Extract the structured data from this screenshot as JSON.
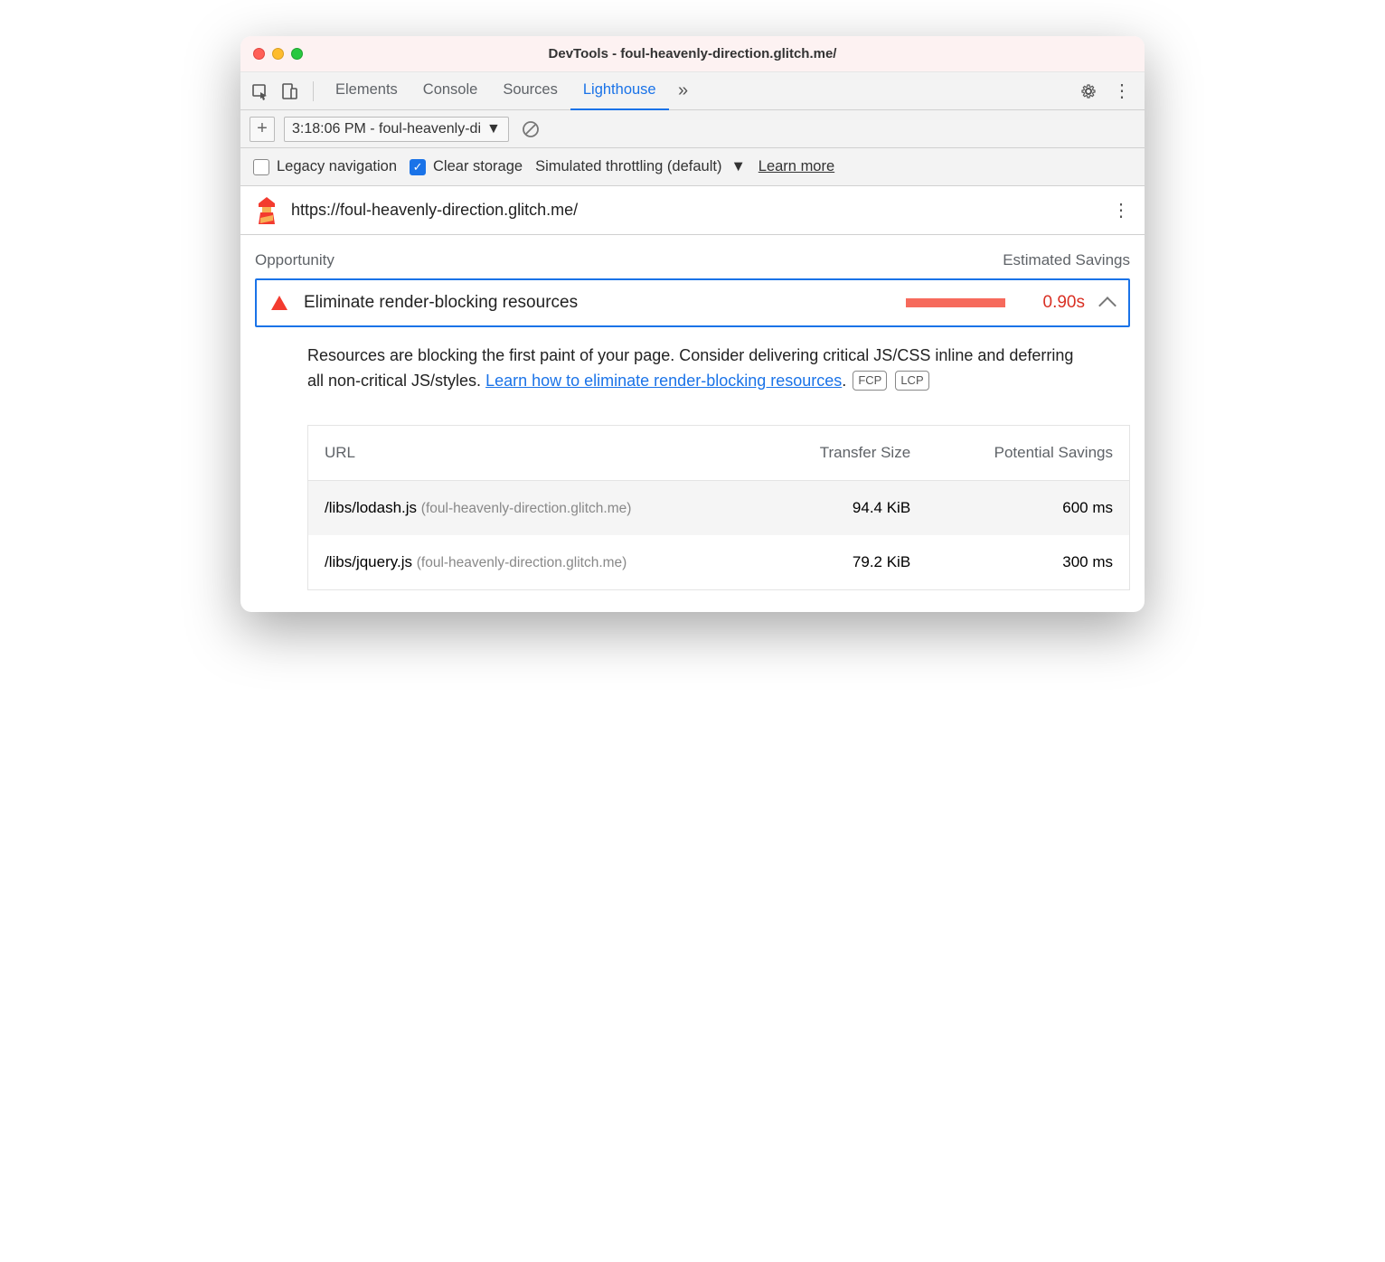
{
  "window": {
    "title": "DevTools - foul-heavenly-direction.glitch.me/"
  },
  "toolbar": {
    "tabs": [
      "Elements",
      "Console",
      "Sources",
      "Lighthouse"
    ],
    "active_tab": 3
  },
  "subbar": {
    "report_label": "3:18:06 PM - foul-heavenly-di"
  },
  "options": {
    "legacy_label": "Legacy navigation",
    "legacy_checked": false,
    "clear_label": "Clear storage",
    "clear_checked": true,
    "throttling_label": "Simulated throttling (default)",
    "learn_more": "Learn more"
  },
  "urlbar": {
    "url": "https://foul-heavenly-direction.glitch.me/"
  },
  "report": {
    "col_opportunity": "Opportunity",
    "col_savings": "Estimated Savings",
    "audit": {
      "title": "Eliminate render-blocking resources",
      "value": "0.90s"
    },
    "detail": {
      "text_a": "Resources are blocking the first paint of your page. Consider delivering critical JS/CSS inline and deferring all non-critical JS/styles. ",
      "link": "Learn how to eliminate render-blocking resources",
      "text_b": ".",
      "badge1": "FCP",
      "badge2": "LCP"
    },
    "table": {
      "h_url": "URL",
      "h_size": "Transfer Size",
      "h_save": "Potential Savings",
      "rows": [
        {
          "path": "/libs/lodash.js",
          "host": "(foul-heavenly-direction.glitch.me)",
          "size": "94.4 KiB",
          "save": "600 ms"
        },
        {
          "path": "/libs/jquery.js",
          "host": "(foul-heavenly-direction.glitch.me)",
          "size": "79.2 KiB",
          "save": "300 ms"
        }
      ]
    }
  }
}
